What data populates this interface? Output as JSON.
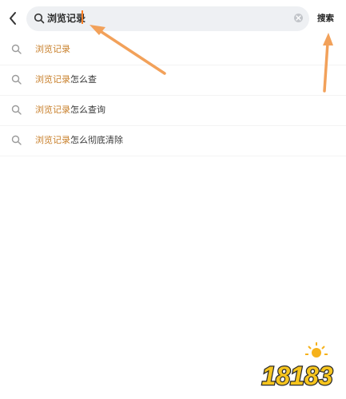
{
  "search": {
    "query": "浏览记录",
    "submit_label": "搜索"
  },
  "suggestions": [
    {
      "highlight": "浏览记录",
      "rest": ""
    },
    {
      "highlight": "浏览记录",
      "rest": "怎么查"
    },
    {
      "highlight": "浏览记录",
      "rest": "怎么查询"
    },
    {
      "highlight": "浏览记录",
      "rest": "怎么彻底清除"
    }
  ],
  "watermark": {
    "text": "18183"
  },
  "icons": {
    "back": "chevron-left-icon",
    "search": "search-icon",
    "clear": "clear-icon"
  },
  "colors": {
    "highlight": "#c87f2a",
    "search_bg": "#eef0f3",
    "annotation_arrow": "#f2a15a",
    "caret": "#ff7f24"
  }
}
